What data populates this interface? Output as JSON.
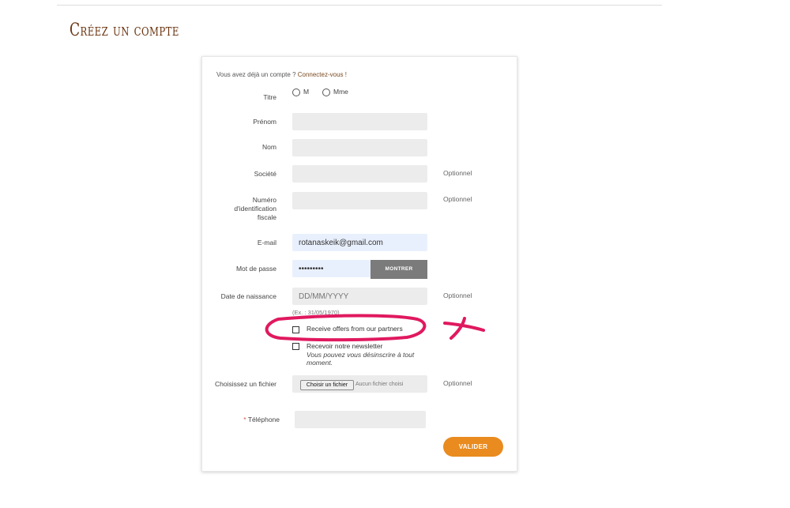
{
  "page": {
    "title": "Créez un compte"
  },
  "login_prompt": {
    "text": "Vous avez déjà un compte ? ",
    "link": "Connectez-vous !"
  },
  "form": {
    "title_label": "Titre",
    "title_options": [
      "M",
      "Mme"
    ],
    "first_name_label": "Prénom",
    "last_name_label": "Nom",
    "company_label": "Société",
    "tax_id_label": "Numéro d'identification fiscale",
    "email_label": "E-mail",
    "email_value": "rotanaskeik@gmail.com",
    "password_label": "Mot de passe",
    "password_value": "•••••••••",
    "show_button": "MONTRER",
    "birthdate_label": "Date de naissance",
    "birthdate_placeholder": "DD/MM/YYYY",
    "birthdate_hint": "(Ex. : 31/05/1970)",
    "optional_text": "Optionnel",
    "partner_offers_label": "Receive offers from our partners",
    "newsletter_label": "Recevoir notre newsletter",
    "newsletter_note": "Vous pouvez vous désinscrire à tout moment.",
    "file_label": "Choisissez un fichier",
    "file_button": "Choisir un fichier",
    "file_none": "Aucun fichier choisi",
    "phone_required_mark": "*",
    "phone_label": "Téléphone",
    "submit_button": "VALIDER"
  },
  "colors": {
    "brand_title": "#6b3410",
    "accent_button": "#e98b1f",
    "annotation": "#e0195f"
  }
}
